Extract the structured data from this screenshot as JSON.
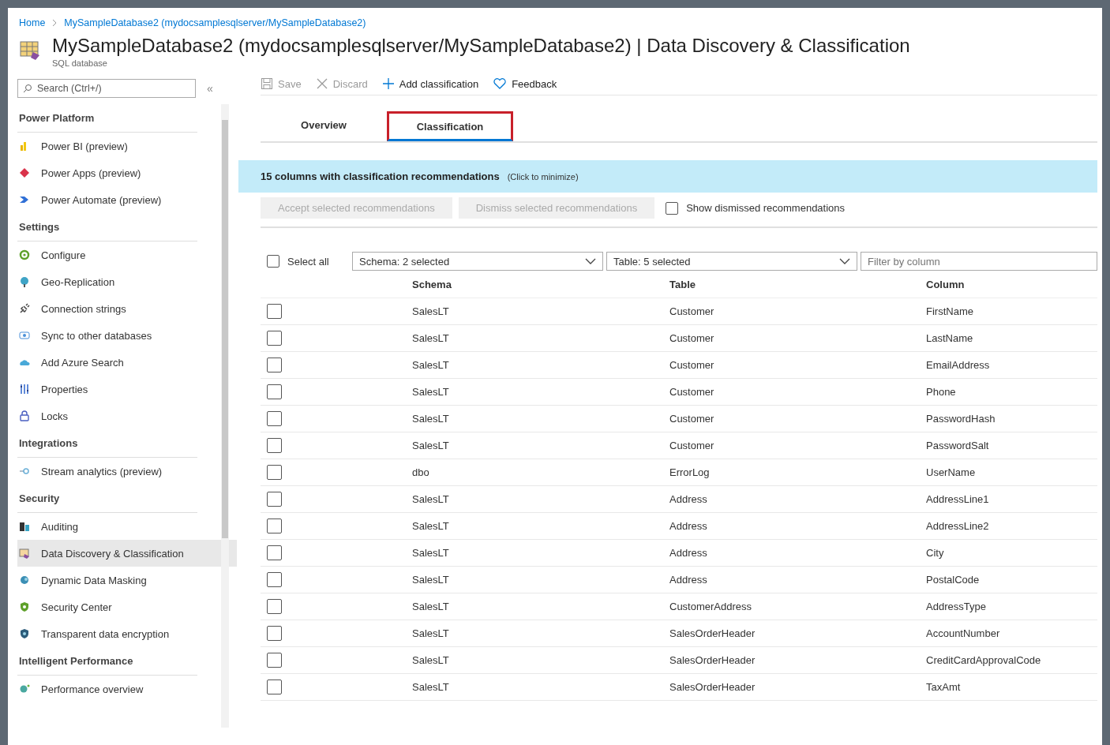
{
  "breadcrumb": [
    "Home",
    "MySampleDatabase2 (mydocsamplesqlserver/MySampleDatabase2)"
  ],
  "header": {
    "title": "MySampleDatabase2 (mydocsamplesqlserver/MySampleDatabase2) | Data Discovery & Classification",
    "subtitle": "SQL database"
  },
  "sidebar": {
    "search": {
      "placeholder": "Search (Ctrl+/)"
    },
    "collapse": "«",
    "sections": [
      {
        "title": "Power Platform",
        "items": [
          {
            "label": "Power BI (preview)",
            "selected": false
          },
          {
            "label": "Power Apps (preview)",
            "selected": false
          },
          {
            "label": "Power Automate (preview)",
            "selected": false
          }
        ]
      },
      {
        "title": "Settings",
        "items": [
          {
            "label": "Configure",
            "selected": false
          },
          {
            "label": "Geo-Replication",
            "selected": false
          },
          {
            "label": "Connection strings",
            "selected": false
          },
          {
            "label": "Sync to other databases",
            "selected": false
          },
          {
            "label": "Add Azure Search",
            "selected": false
          },
          {
            "label": "Properties",
            "selected": false
          },
          {
            "label": "Locks",
            "selected": false
          }
        ]
      },
      {
        "title": "Integrations",
        "items": [
          {
            "label": "Stream analytics (preview)",
            "selected": false
          }
        ]
      },
      {
        "title": "Security",
        "items": [
          {
            "label": "Auditing",
            "selected": false
          },
          {
            "label": "Data Discovery & Classification",
            "selected": true
          },
          {
            "label": "Dynamic Data Masking",
            "selected": false
          },
          {
            "label": "Security Center",
            "selected": false
          },
          {
            "label": "Transparent data encryption",
            "selected": false
          }
        ]
      },
      {
        "title": "Intelligent Performance",
        "items": [
          {
            "label": "Performance overview",
            "selected": false
          }
        ]
      }
    ]
  },
  "toolbar": [
    {
      "kind": "save",
      "label": "Save",
      "disabled": true
    },
    {
      "kind": "discard",
      "label": "Discard",
      "disabled": true
    },
    {
      "kind": "add",
      "label": "Add classification",
      "disabled": false
    },
    {
      "kind": "feedback",
      "label": "Feedback",
      "disabled": false
    }
  ],
  "tabs": [
    {
      "label": "Overview",
      "selected": false
    },
    {
      "label": "Classification",
      "selected": true
    }
  ],
  "banner": {
    "title": "15 columns with classification recommendations",
    "hint": "(Click to minimize)"
  },
  "actions": [
    {
      "label": "Accept selected recommendations",
      "disabled": true
    },
    {
      "label": "Dismiss selected recommendations",
      "disabled": true
    }
  ],
  "show_dismissed": {
    "label": "Show dismissed recommendations",
    "checked": false
  },
  "filters": {
    "select_all": {
      "label": "Select all",
      "checked": false
    },
    "schema": "Schema: 2 selected",
    "table": "Table: 5 selected",
    "column_filter": {
      "placeholder": "Filter by column"
    }
  },
  "table": {
    "columns": [
      "Schema",
      "Table",
      "Column"
    ],
    "rows": [
      {
        "checked": false,
        "cells": [
          "SalesLT",
          "Customer",
          "FirstName"
        ]
      },
      {
        "checked": false,
        "cells": [
          "SalesLT",
          "Customer",
          "LastName"
        ]
      },
      {
        "checked": false,
        "cells": [
          "SalesLT",
          "Customer",
          "EmailAddress"
        ]
      },
      {
        "checked": false,
        "cells": [
          "SalesLT",
          "Customer",
          "Phone"
        ]
      },
      {
        "checked": false,
        "cells": [
          "SalesLT",
          "Customer",
          "PasswordHash"
        ]
      },
      {
        "checked": false,
        "cells": [
          "SalesLT",
          "Customer",
          "PasswordSalt"
        ]
      },
      {
        "checked": false,
        "cells": [
          "dbo",
          "ErrorLog",
          "UserName"
        ]
      },
      {
        "checked": false,
        "cells": [
          "SalesLT",
          "Address",
          "AddressLine1"
        ]
      },
      {
        "checked": false,
        "cells": [
          "SalesLT",
          "Address",
          "AddressLine2"
        ]
      },
      {
        "checked": false,
        "cells": [
          "SalesLT",
          "Address",
          "City"
        ]
      },
      {
        "checked": false,
        "cells": [
          "SalesLT",
          "Address",
          "PostalCode"
        ]
      },
      {
        "checked": false,
        "cells": [
          "SalesLT",
          "CustomerAddress",
          "AddressType"
        ]
      },
      {
        "checked": false,
        "cells": [
          "SalesLT",
          "SalesOrderHeader",
          "AccountNumber"
        ]
      },
      {
        "checked": false,
        "cells": [
          "SalesLT",
          "SalesOrderHeader",
          "CreditCardApprovalCode"
        ]
      },
      {
        "checked": false,
        "cells": [
          "SalesLT",
          "SalesOrderHeader",
          "TaxAmt"
        ]
      }
    ]
  }
}
